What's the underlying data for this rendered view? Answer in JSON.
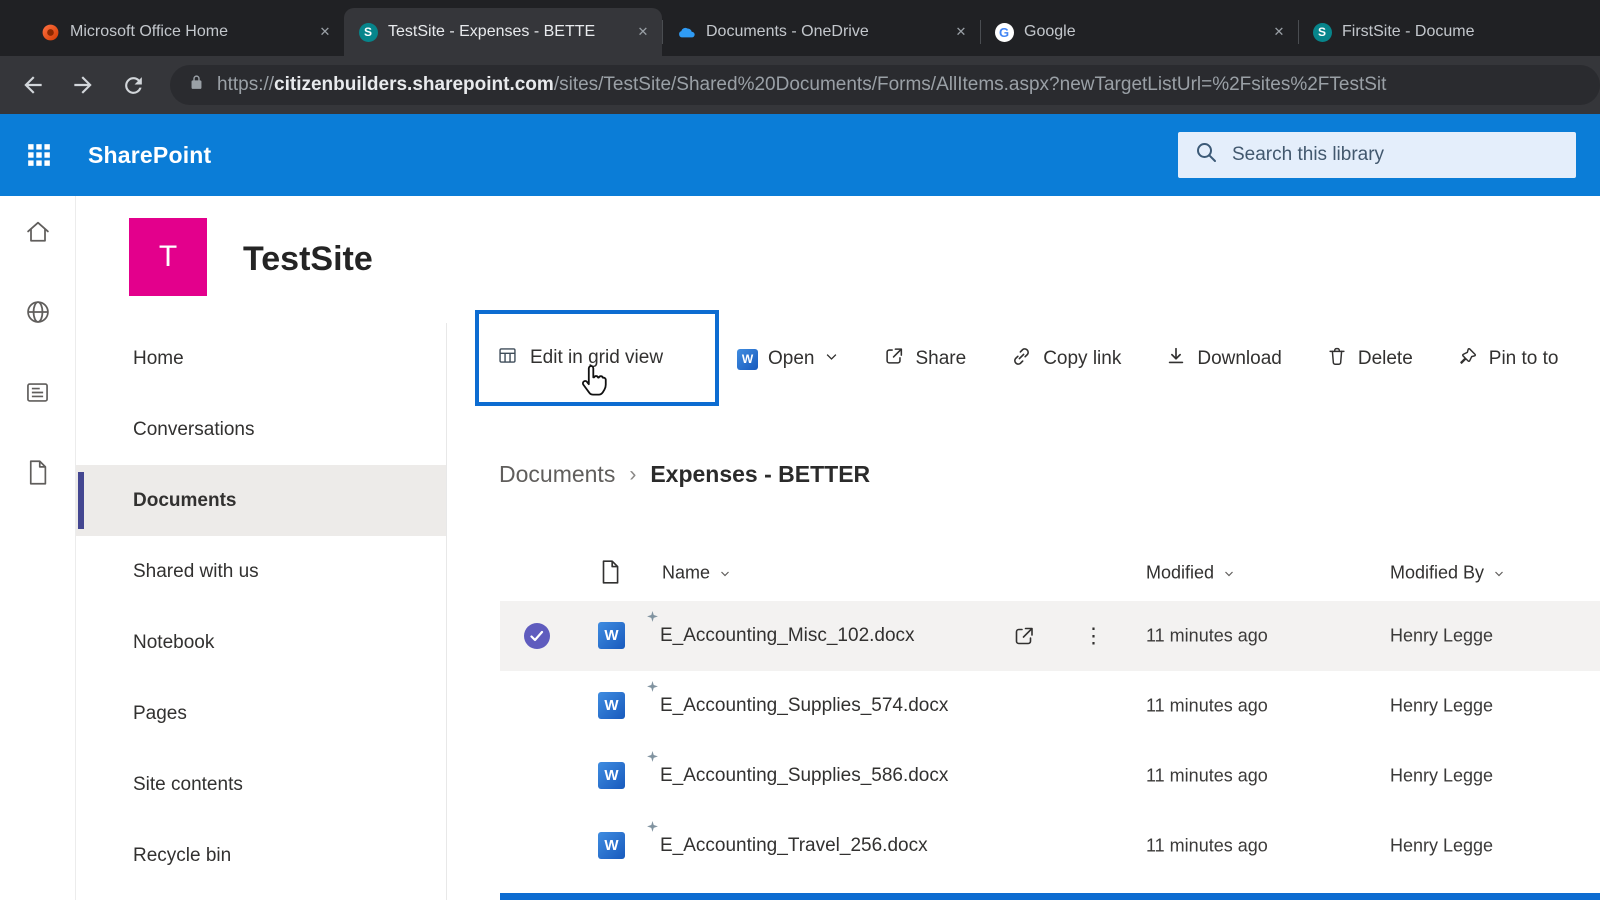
{
  "colors": {
    "sharepoint_blue": "#0b7dd7",
    "site_logo_pink": "#e3008c",
    "selection_check_purple": "#5f5cbe",
    "annotation_highlight_blue": "#0d6cd1",
    "word_blue": "#185abd"
  },
  "browser": {
    "tabs": [
      {
        "title": "Microsoft Office Home",
        "icon": "office-icon",
        "active": false
      },
      {
        "title": "TestSite - Expenses - BETTE",
        "icon": "sharepoint-icon",
        "active": true
      },
      {
        "title": "Documents - OneDrive",
        "icon": "onedrive-icon",
        "active": false
      },
      {
        "title": "Google",
        "icon": "google-icon",
        "active": false
      },
      {
        "title": "FirstSite - Docume",
        "icon": "sharepoint-icon",
        "active": false
      }
    ],
    "address": {
      "protocol": "https://",
      "domain": "citizenbuilders.sharepoint.com",
      "path": "/sites/TestSite/Shared%20Documents/Forms/AllItems.aspx?newTargetListUrl=%2Fsites%2FTestSit"
    }
  },
  "suite_bar": {
    "brand": "SharePoint",
    "search_placeholder": "Search this library"
  },
  "site": {
    "logo_letter": "T",
    "title": "TestSite"
  },
  "left_nav": {
    "items": [
      {
        "label": "Home",
        "selected": false
      },
      {
        "label": "Conversations",
        "selected": false
      },
      {
        "label": "Documents",
        "selected": true
      },
      {
        "label": "Shared with us",
        "selected": false
      },
      {
        "label": "Notebook",
        "selected": false
      },
      {
        "label": "Pages",
        "selected": false
      },
      {
        "label": "Site contents",
        "selected": false
      },
      {
        "label": "Recycle bin",
        "selected": false
      }
    ]
  },
  "command_bar": {
    "edit_grid_label": "Edit in grid view",
    "open_label": "Open",
    "share_label": "Share",
    "copy_link_label": "Copy link",
    "download_label": "Download",
    "delete_label": "Delete",
    "pin_label": "Pin to to"
  },
  "breadcrumb": {
    "parent": "Documents",
    "separator": "›",
    "current": "Expenses - BETTER"
  },
  "file_list": {
    "columns": {
      "name": "Name",
      "modified": "Modified",
      "modified_by": "Modified By"
    },
    "rows": [
      {
        "name": "E_Accounting_Misc_102.docx",
        "modified": "11 minutes ago",
        "modified_by": "Henry Legge",
        "selected": true
      },
      {
        "name": "E_Accounting_Supplies_574.docx",
        "modified": "11 minutes ago",
        "modified_by": "Henry Legge",
        "selected": false
      },
      {
        "name": "E_Accounting_Supplies_586.docx",
        "modified": "11 minutes ago",
        "modified_by": "Henry Legge",
        "selected": false
      },
      {
        "name": "E_Accounting_Travel_256.docx",
        "modified": "11 minutes ago",
        "modified_by": "Henry Legge",
        "selected": false
      }
    ]
  }
}
